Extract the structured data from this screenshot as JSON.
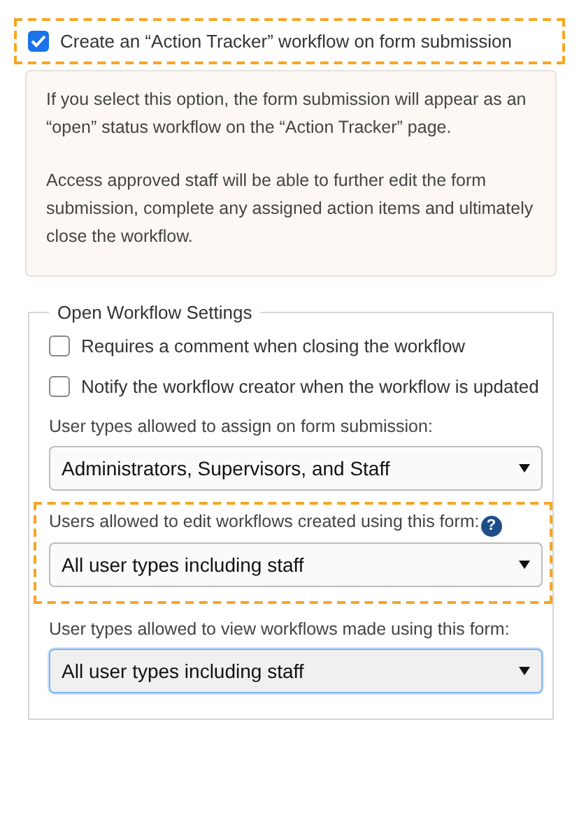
{
  "tracker_option": {
    "label": "Create an “Action Tracker” workflow on form submission",
    "checked": true,
    "highlighted": true
  },
  "info": [
    "If you select this option, the form submission will appear as an “open” status workflow on the “Action Tracker” page.",
    "Access approved staff will be able to further edit the form submission, complete any assigned action items and ultimately close the workflow."
  ],
  "settings": {
    "legend": "Open Workflow Settings",
    "items": [
      {
        "kind": "checkbox",
        "label": "Requires a comment when closing the workflow",
        "checked": false
      },
      {
        "kind": "checkbox",
        "label": "Notify the workflow creator when the workflow is updated",
        "checked": false
      },
      {
        "kind": "select",
        "label": "User types allowed to assign on form submission:",
        "value": "Administrators, Supervisors, and Staff",
        "highlighted": false,
        "focused": false
      },
      {
        "kind": "select",
        "label": "Users allowed to edit workflows created using this form:",
        "help": "?",
        "value": "All user types including staff",
        "highlighted": true,
        "focused": false
      },
      {
        "kind": "select",
        "label": "User types allowed to view workflows made using this form:",
        "value": "All user types including staff",
        "highlighted": false,
        "focused": true
      }
    ]
  }
}
